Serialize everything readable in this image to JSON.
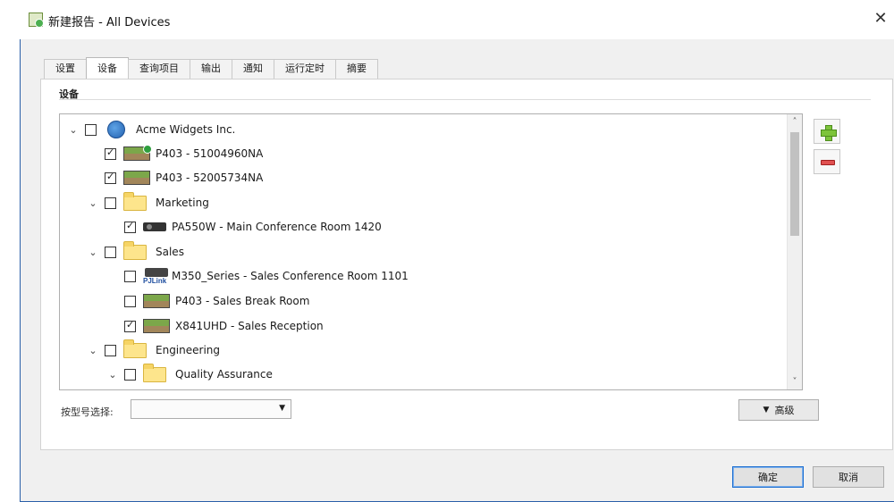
{
  "window": {
    "title": "新建报告 - All Devices",
    "close_glyph": "✕"
  },
  "tabs": [
    {
      "label": "设置",
      "active": false
    },
    {
      "label": "设备",
      "active": true
    },
    {
      "label": "查询项目",
      "active": false
    },
    {
      "label": "输出",
      "active": false
    },
    {
      "label": "通知",
      "active": false
    },
    {
      "label": "运行定时",
      "active": false
    },
    {
      "label": "摘要",
      "active": false
    }
  ],
  "panel": {
    "group_label": "设备"
  },
  "tree": [
    {
      "label": "Acme Widgets Inc.",
      "icon": "org-icon",
      "checked": false,
      "expanded": true,
      "level": 0
    },
    {
      "label": "P403 - 51004960NA",
      "icon": "projector-icon",
      "checked": true,
      "level": 1
    },
    {
      "label": "P403 - 52005734NA",
      "icon": "projector-icon",
      "checked": true,
      "level": 1
    },
    {
      "label": "Marketing",
      "icon": "folder-icon",
      "checked": false,
      "expanded": true,
      "level": 1
    },
    {
      "label": "PA550W - Main Conference Room 1420",
      "icon": "dark-projector-icon",
      "checked": true,
      "level": 2
    },
    {
      "label": "Sales",
      "icon": "folder-icon",
      "checked": false,
      "expanded": true,
      "level": 1
    },
    {
      "label": "M350_Series - Sales Conference Room 1101",
      "icon": "pjlink-projector-icon",
      "icon_text": "PJLink",
      "checked": false,
      "level": 2
    },
    {
      "label": "P403 - Sales Break Room",
      "icon": "projector-icon",
      "checked": false,
      "level": 2
    },
    {
      "label": "X841UHD - Sales Reception",
      "icon": "projector-icon",
      "checked": true,
      "level": 2
    },
    {
      "label": "Engineering",
      "icon": "folder-icon",
      "checked": false,
      "expanded": true,
      "level": 1
    },
    {
      "label": "Quality Assurance",
      "icon": "folder-icon",
      "checked": false,
      "expanded": true,
      "level": 2
    }
  ],
  "filter": {
    "label": "按型号选择:",
    "value": ""
  },
  "advanced_button": {
    "label": "高级",
    "glyph": "▼"
  },
  "footer": {
    "ok_label": "确定",
    "cancel_label": "取消"
  },
  "icons": {
    "expand": "⌄",
    "scroll_up": "˄",
    "scroll_down": "˅",
    "select_arrow": "▼"
  },
  "colors": {
    "window_border": "#2a5fa8",
    "add_green": "#7dc43a",
    "remove_red": "#e05050",
    "default_button_border": "#1e6fd0"
  }
}
